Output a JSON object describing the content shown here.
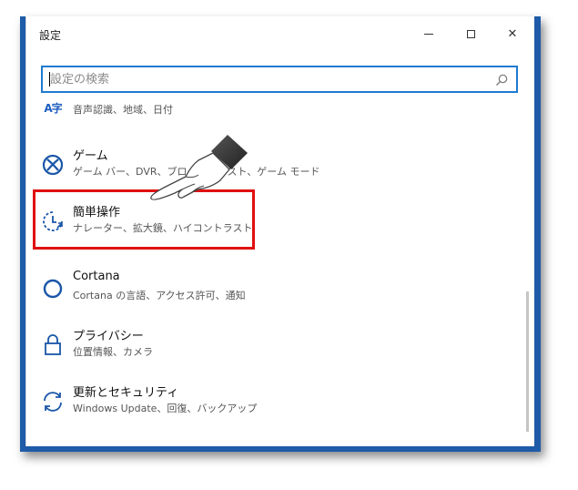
{
  "window": {
    "title": "設定",
    "controls": {
      "minimize_icon": "minimize-icon",
      "maximize_icon": "maximize-icon",
      "close_icon": "close-icon",
      "close_glyph": "✕"
    }
  },
  "search": {
    "placeholder": "設定の検索",
    "value": "",
    "icon": "search-icon"
  },
  "items": [
    {
      "icon": "speech-language-icon",
      "icon_text": "A字",
      "title": "",
      "desc": "音声認識、地域、日付"
    },
    {
      "icon": "xbox-icon",
      "title": "ゲーム",
      "desc": "ゲーム バー、DVR、ブロードキャスト、ゲーム モード"
    },
    {
      "icon": "ease-of-access-icon",
      "title": "簡単操作",
      "desc": "ナレーター、拡大鏡、ハイコントラスト"
    },
    {
      "icon": "cortana-icon",
      "title": "Cortana",
      "desc": "Cortana の言語、アクセス許可、通知"
    },
    {
      "icon": "lock-icon",
      "title": "プライバシー",
      "desc": "位置情報、カメラ"
    },
    {
      "icon": "sync-icon",
      "title": "更新とセキュリティ",
      "desc": "Windows Update、回復、バックアップ"
    }
  ],
  "colors": {
    "accent": "#1f7ad1",
    "frame": "#1e5ba8",
    "highlight": "#e01010",
    "text": "#111111",
    "subtext": "#555555"
  }
}
